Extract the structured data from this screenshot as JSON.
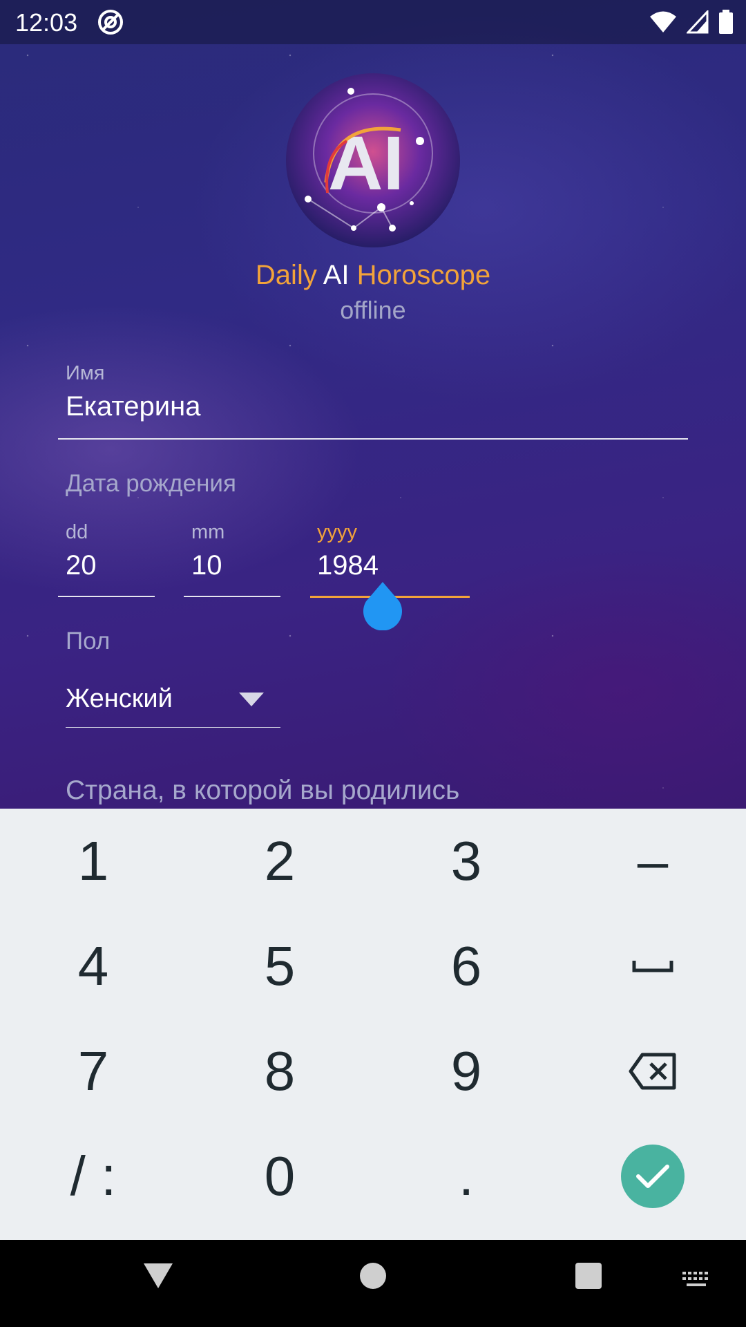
{
  "status_bar": {
    "time": "12:03"
  },
  "app": {
    "title_parts": [
      "Daily ",
      "AI ",
      "Horoscope"
    ],
    "subtitle": "offline",
    "logo_text": "AI"
  },
  "form": {
    "name": {
      "label": "Имя",
      "value": "Екатерина"
    },
    "birth_date": {
      "label": "Дата рождения",
      "day": {
        "label": "dd",
        "value": "20"
      },
      "month": {
        "label": "mm",
        "value": "10"
      },
      "year": {
        "label": "yyyy",
        "value": "1984"
      }
    },
    "gender": {
      "label": "Пол",
      "value": "Женский"
    },
    "country": {
      "placeholder": "Страна, в которой вы родились"
    }
  },
  "keyboard": {
    "rows": [
      [
        "1",
        "2",
        "3",
        "–"
      ],
      [
        "4",
        "5",
        "6",
        "␣"
      ],
      [
        "7",
        "8",
        "9",
        "⌫"
      ],
      [
        "/ :",
        "0",
        ".",
        "✓"
      ]
    ]
  },
  "colors": {
    "accent": "#f2a33a",
    "cursor": "#2196f3",
    "enter": "#49b3a0"
  }
}
